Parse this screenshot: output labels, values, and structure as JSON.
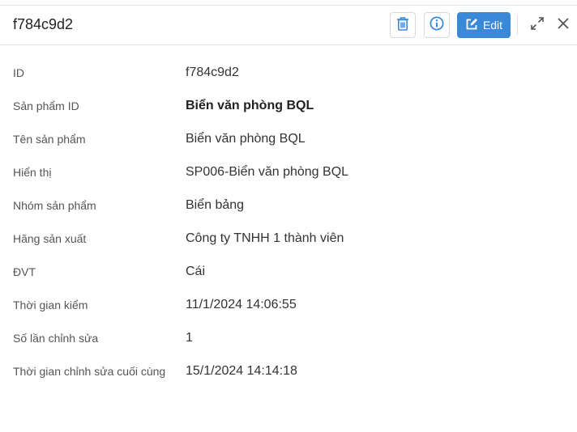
{
  "header": {
    "title": "f784c9d2",
    "edit_label": "Edit",
    "icons": {
      "delete": "trash-icon",
      "info": "info-icon",
      "edit": "edit-icon",
      "expand": "expand-icon",
      "close": "close-icon"
    },
    "colors": {
      "primary": "#3a89d8",
      "icon": "#3a89d8"
    }
  },
  "fields": [
    {
      "label": "ID",
      "value": "f784c9d2"
    },
    {
      "label": "Sản phẩm ID",
      "value": "Biển văn phòng BQL"
    },
    {
      "label": "Tên sản phẩm",
      "value": "Biển văn phòng BQL"
    },
    {
      "label": "Hiển thị",
      "value": "SP006-Biển văn phòng BQL"
    },
    {
      "label": "Nhóm sản phẩm",
      "value": "Biển bảng"
    },
    {
      "label": "Hãng sản xuất",
      "value": "Công ty TNHH 1 thành viên"
    },
    {
      "label": "ĐVT",
      "value": "Cái"
    },
    {
      "label": "Thời gian kiểm",
      "value": "11/1/2024 14:06:55"
    },
    {
      "label": "Số lần chỉnh sửa",
      "value": "1"
    },
    {
      "label": "Thời gian chỉnh sửa cuối cùng",
      "value": "15/1/2024 14:14:18"
    }
  ]
}
